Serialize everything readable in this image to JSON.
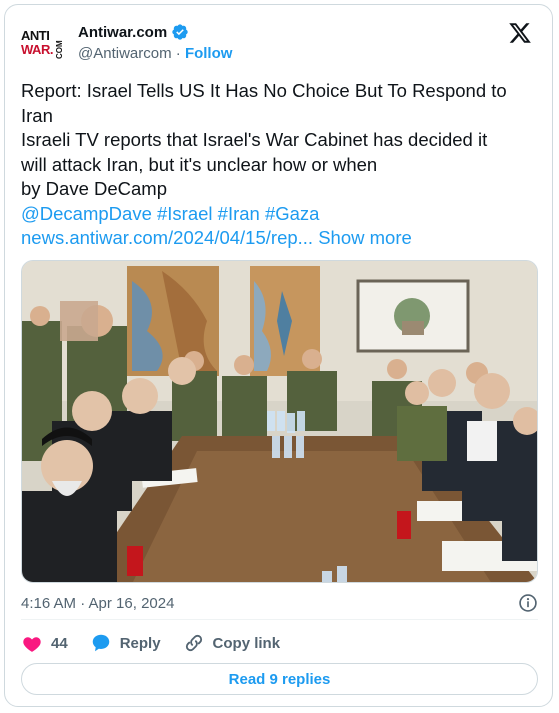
{
  "account": {
    "logo_line1": "ANTI",
    "logo_line2": "WAR.",
    "logo_side": "COM",
    "name": "Antiwar.com",
    "handle": "@Antiwarcom",
    "separator": "·",
    "follow_label": "Follow"
  },
  "tweet": {
    "line1": "Report: Israel Tells US It Has No Choice But To Respond to",
    "line2": "Iran",
    "line3": "Israeli TV reports that Israel's War Cabinet has decided it",
    "line4": "will attack Iran, but it's unclear how or when",
    "line5": "by Dave DeCamp",
    "tags": "@DecampDave #Israel #Iran #Gaza",
    "link": "news.antiwar.com/2024/04/15/rep...",
    "show_more": "Show more"
  },
  "timestamp": "4:16 AM · Apr 16, 2024",
  "actions": {
    "like_count": "44",
    "reply_label": "Reply",
    "copy_label": "Copy link"
  },
  "read_replies_label": "Read 9 replies",
  "colors": {
    "accent": "#1d9bf0",
    "like": "#f91880",
    "verified": "#1d9bf0"
  }
}
